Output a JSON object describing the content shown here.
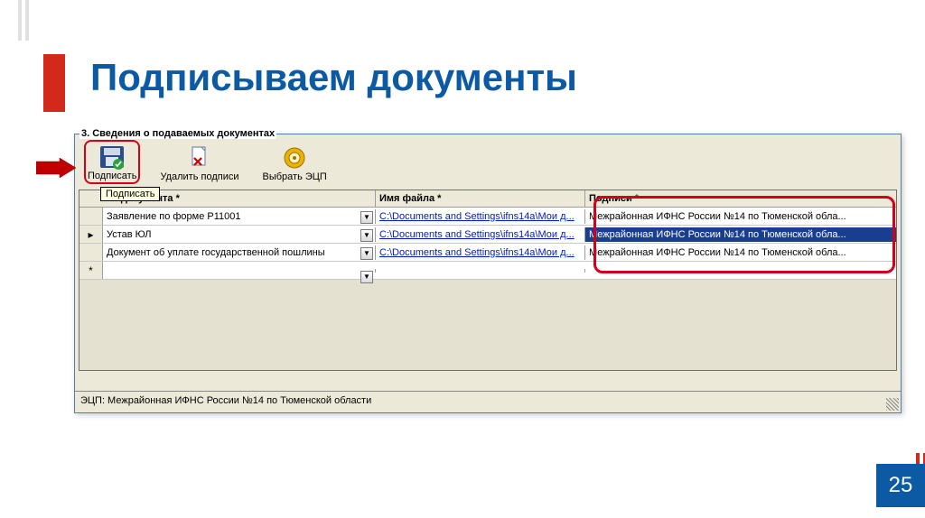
{
  "title": "Подписываем документы",
  "section_header": "3. Сведения о подаваемых документах",
  "toolbar": {
    "sign": "Подписать",
    "delete": "Удалить подписи",
    "select_ecp": "Выбрать ЭЦП"
  },
  "tooltip": "Подписать",
  "grid": {
    "headers": {
      "name": "ие документа *",
      "file": "Имя файла *",
      "sign": "Подписи *"
    },
    "rows": [
      {
        "marker": "",
        "name": "Заявление по форме Р11001",
        "file": "C:\\Documents and Settings\\ifns14a\\Мои д...",
        "sign": "Межрайонная ИФНС России №14 по Тюменской обла...",
        "selected": false
      },
      {
        "marker": "▸",
        "name": "Устав ЮЛ",
        "file": "C:\\Documents and Settings\\ifns14a\\Мои д...",
        "sign": "Межрайонная ИФНС России №14 по Тюменской обла...",
        "selected": true
      },
      {
        "marker": "",
        "name": "Документ об уплате государственной пошлины",
        "file": "C:\\Documents and Settings\\ifns14a\\Мои д...",
        "sign": "Межрайонная ИФНС России №14 по Тюменской обла...",
        "selected": false
      },
      {
        "marker": "*",
        "name": "",
        "file": "",
        "sign": "",
        "selected": false
      }
    ]
  },
  "status": "ЭЦП: Межрайонная ИФНС России №14 по Тюменской области",
  "page": "25"
}
